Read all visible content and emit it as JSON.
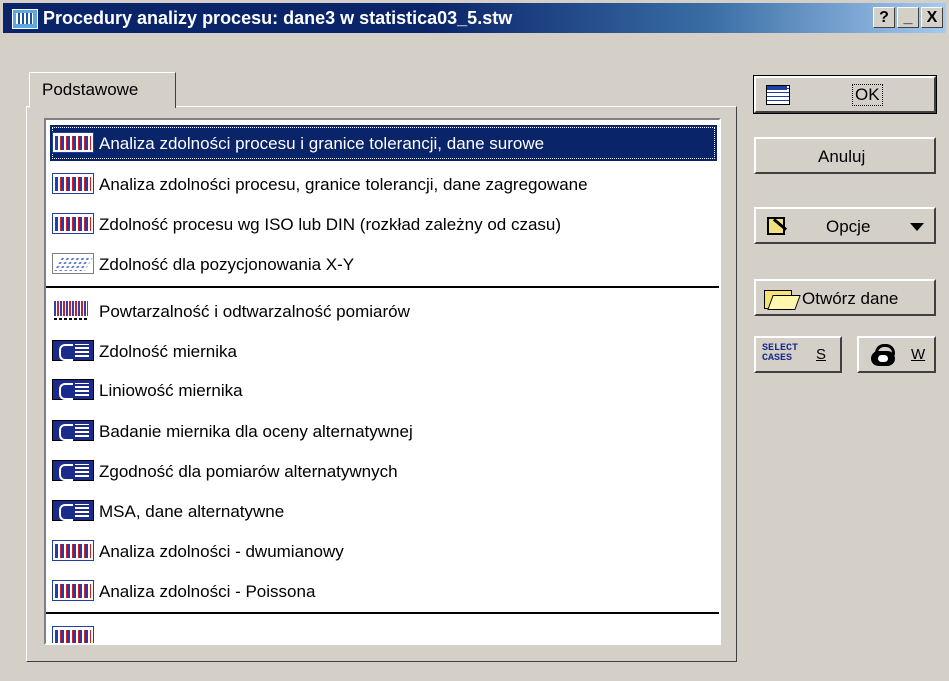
{
  "window": {
    "title": "Procedury analizy procesu: dane3 w statistica03_5.stw",
    "controls": {
      "help": "?",
      "minimize": "_",
      "close": "X"
    }
  },
  "tabs": [
    {
      "label": "Podstawowe",
      "active": true
    }
  ],
  "procedures": [
    {
      "label": "Analiza zdolności procesu i granice tolerancji, dane surowe",
      "icon": "process-histogram-icon",
      "selected": true
    },
    {
      "label": "Analiza zdolności procesu, granice tolerancji, dane zagregowane",
      "icon": "process-histogram-icon"
    },
    {
      "label": "Zdolność procesu wg ISO lub DIN (rozkład zależny od czasu)",
      "icon": "process-histogram-icon"
    },
    {
      "label": "Zdolność dla pozycjonowania X-Y",
      "icon": "scatter-plot-icon"
    },
    {
      "label": "Powtarzalność i odtwarzalność pomiarów",
      "icon": "repeatability-chart-icon"
    },
    {
      "label": "Zdolność miernika",
      "icon": "gauge-icon"
    },
    {
      "label": "Liniowość miernika",
      "icon": "gauge-icon"
    },
    {
      "label": "Badanie miernika dla oceny alternatywnej",
      "icon": "gauge-icon"
    },
    {
      "label": "Zgodność dla pomiarów alternatywnych",
      "icon": "gauge-icon"
    },
    {
      "label": "MSA, dane alternatywne",
      "icon": "gauge-icon"
    },
    {
      "label": "Analiza zdolności - dwumianowy",
      "icon": "process-histogram-icon"
    },
    {
      "label": "Analiza zdolności - Poissona",
      "icon": "process-histogram-icon"
    }
  ],
  "buttons": {
    "ok": "OK",
    "cancel": "Anuluj",
    "options": "Opcje",
    "open_data": "Otwórz dane",
    "select_cases_icon_text": "SELECT CASES",
    "select_cases_key": "S",
    "weights_key": "W"
  },
  "colors": {
    "titlebar": "#0a246a",
    "selection": "#0a246a",
    "dialog_bg": "#d4d0c8"
  }
}
